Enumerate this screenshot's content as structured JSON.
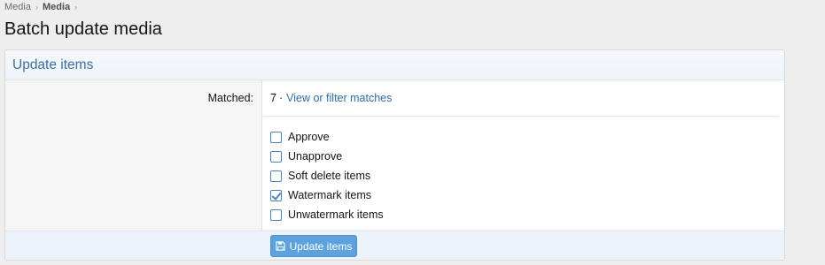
{
  "breadcrumb": {
    "items": [
      "Media",
      "Media"
    ],
    "separator": "›"
  },
  "page": {
    "title": "Batch update media"
  },
  "block": {
    "header": "Update items",
    "matched_label": "Matched:",
    "matched_count": "7",
    "matched_sep": "·",
    "matched_link": "View or filter matches",
    "options": [
      {
        "label": "Approve",
        "checked": false
      },
      {
        "label": "Unapprove",
        "checked": false
      },
      {
        "label": "Soft delete items",
        "checked": false
      },
      {
        "label": "Watermark items",
        "checked": true
      },
      {
        "label": "Unwatermark items",
        "checked": false
      }
    ],
    "submit_label": "Update items",
    "submit_icon": "save-icon"
  },
  "colors": {
    "accent": "#2f6ea5",
    "header_text": "#3e6f9e",
    "button_bg": "#5da2dc"
  }
}
